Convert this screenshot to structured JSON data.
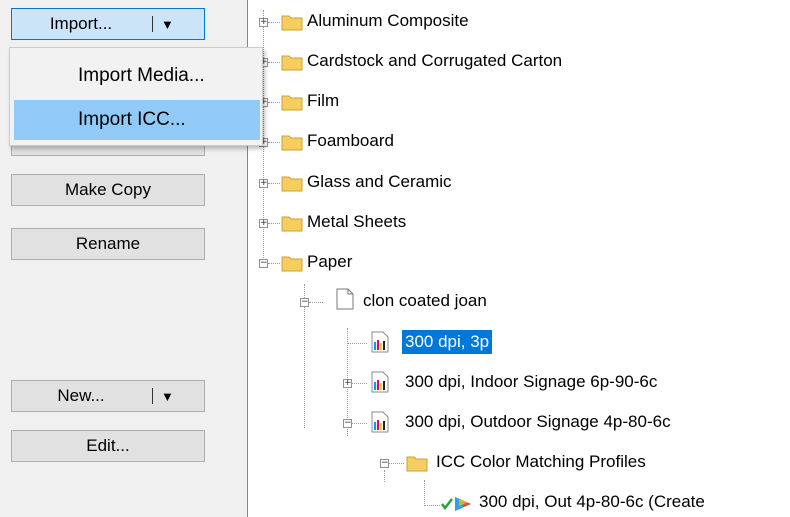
{
  "buttons": {
    "import": {
      "label": "Import...",
      "arrow": "▼"
    },
    "make_copy": "Make Copy",
    "rename": "Rename",
    "new": {
      "label": "New...",
      "arrow": "▼"
    },
    "edit": "Edit..."
  },
  "import_menu": {
    "items": [
      "Import Media...",
      "Import ICC..."
    ],
    "highlighted": "Import ICC..."
  },
  "tree": {
    "nodes": [
      {
        "label": "Aluminum Composite",
        "type": "folder",
        "state": "collapsed"
      },
      {
        "label": "Cardstock and Corrugated Carton",
        "type": "folder",
        "state": "collapsed"
      },
      {
        "label": "Film",
        "type": "folder",
        "state": "collapsed"
      },
      {
        "label": "Foamboard",
        "type": "folder",
        "state": "collapsed"
      },
      {
        "label": "Glass and Ceramic",
        "type": "folder",
        "state": "collapsed"
      },
      {
        "label": "Metal Sheets",
        "type": "folder",
        "state": "collapsed"
      },
      {
        "label": "Paper",
        "type": "folder",
        "state": "expanded"
      },
      {
        "label": "clon coated joan",
        "type": "media",
        "state": "expanded"
      },
      {
        "label": "300 dpi, 3p",
        "type": "ink-mode",
        "state": "leaf",
        "selected": true
      },
      {
        "label": "300 dpi, Indoor Signage 6p-90-6c",
        "type": "ink-mode",
        "state": "collapsed"
      },
      {
        "label": "300 dpi, Outdoor Signage 4p-80-6c",
        "type": "ink-mode",
        "state": "expanded"
      },
      {
        "label": "ICC Color Matching Profiles",
        "type": "folder",
        "state": "expanded"
      },
      {
        "label": "300 dpi, Out 4p-80-6c (Create",
        "type": "icc-profile",
        "state": "leaf"
      }
    ]
  },
  "colors": {
    "selection": "#0078d7",
    "menu_highlight": "#91c9f7",
    "folder": "#f6cd5f"
  }
}
